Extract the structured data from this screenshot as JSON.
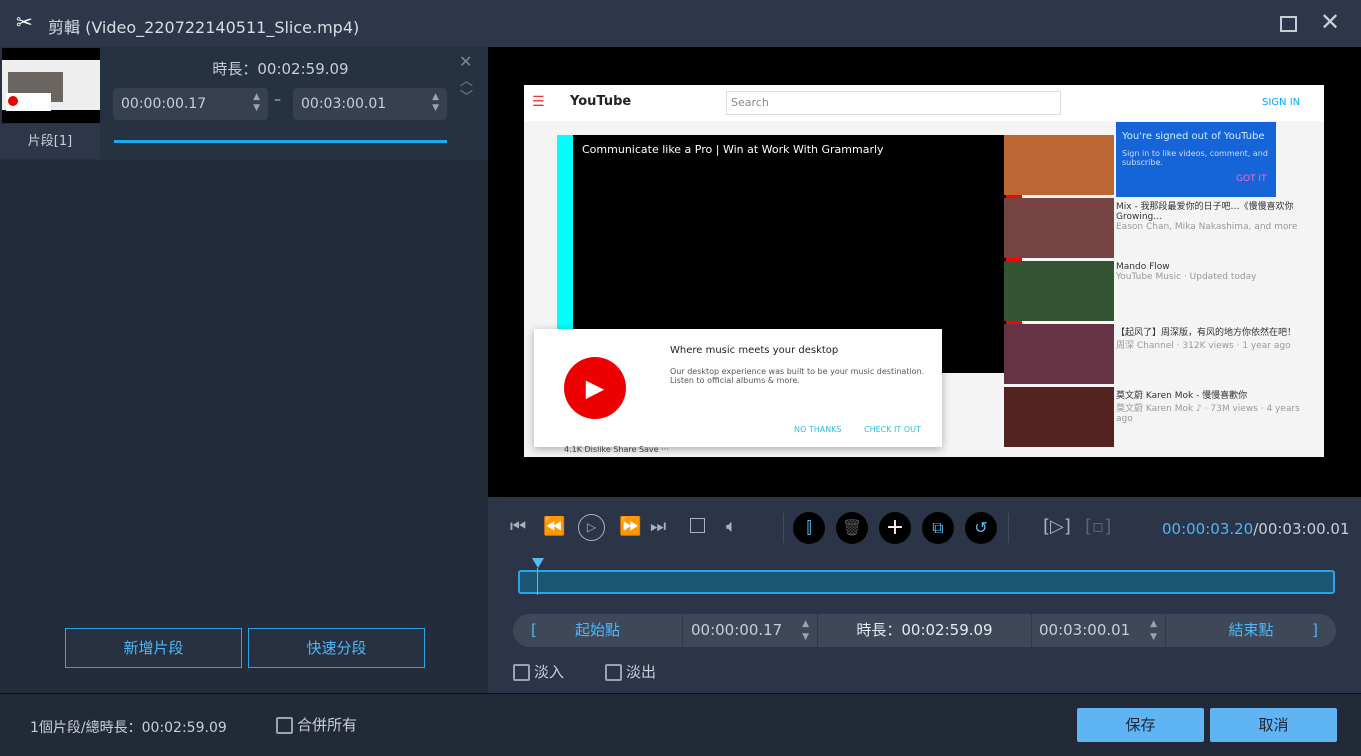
{
  "window": {
    "title": "剪輯 (Video_220722140511_Slice.mp4)",
    "icons": [
      "scissors-icon",
      "maximize-icon",
      "close-icon"
    ]
  },
  "clip_list": {
    "clip_label": "片段[1]",
    "duration": "時長：00:02:59.09",
    "start": "00:00:00.17",
    "end": "00:03:00.01",
    "separator": "–"
  },
  "left_buttons": {
    "add_segment": "新增片段",
    "quick_split": "快速分段"
  },
  "preview": {
    "site": "YouTube",
    "search_placeholder": "Search",
    "sign_in": "SIGN IN",
    "video_title": "Communicate like a Pro | Win at Work With Grammarly",
    "signed_out_title": "You're signed out of YouTube",
    "signed_out_text": "Sign in to like videos, comment, and subscribe.",
    "got_it": "GOT IT",
    "popup_title": "Where music meets your desktop",
    "popup_text": "Our desktop experience was built to be your music destination. Listen to official albums & more.",
    "no_thanks": "NO THANKS",
    "check_it_out": "CHECK IT OUT",
    "actions": "4.1K  Dislike  Share  Save  ···",
    "recs": [
      {
        "title": "Mix - 我那段最爱你的日子吧…《慢慢喜欢你 Growing…",
        "meta": "Eason Chan, Mika Nakashima, and more"
      },
      {
        "title": "Mando Flow",
        "meta": "YouTube Music · Updated today"
      },
      {
        "title": "【起风了】周深版，有风的地方你依然在吧！",
        "meta": "周深 Channel · 312K views · 1 year ago"
      },
      {
        "title": "莫文蔚 Karen Mok - 慢慢喜歡你",
        "meta": "莫文蔚 Karen Mok ♪ · 73M views · 4 years ago"
      }
    ]
  },
  "player": {
    "current_time": "00:00:03.20",
    "total_time": "/00:03:00.01",
    "progress_percent": 1.8
  },
  "range": {
    "start_label": "起始點",
    "start": "00:00:00.17",
    "duration": "時長：00:02:59.09",
    "end": "00:03:00.01",
    "end_label": "結束點"
  },
  "fades": {
    "fade_in": "淡入",
    "fade_out": "淡出"
  },
  "footer": {
    "summary": "1個片段/總時長：00:02:59.09",
    "merge_all": "合併所有",
    "save": "保存",
    "cancel": "取消"
  },
  "colors": {
    "accent": "#2ba3e8",
    "save_button": "#5fb4f4"
  }
}
